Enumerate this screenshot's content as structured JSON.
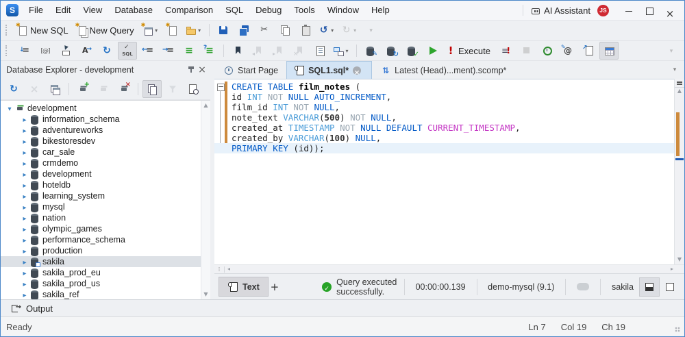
{
  "window": {
    "logo_letter": "S"
  },
  "colors": {
    "accent_blue": "#2f76c4",
    "keyword": "#0058c6",
    "datatype": "#4a9cd8",
    "secondary_keyword_gray": "#9aa7b2",
    "builtin_magenta": "#c436c4",
    "change_bar_orange": "#cd8a3c",
    "success_green": "#27a327",
    "execute_red": "#c00000",
    "active_tab": "#d3e4f5",
    "tree_selection": "#dde1e6"
  },
  "menubar": {
    "items": [
      "File",
      "Edit",
      "View",
      "Database",
      "Comparison",
      "SQL",
      "Debug",
      "Tools",
      "Window",
      "Help"
    ],
    "right": {
      "ai_label": "AI Assistant",
      "badge": "JS"
    },
    "window_controls": [
      "minimize",
      "maximize",
      "close-window"
    ]
  },
  "toolbar_main": [
    {
      "icon": "grip"
    },
    {
      "icon": "new-sql",
      "label": "New SQL"
    },
    {
      "icon": "new-query",
      "label": "New Query"
    },
    {
      "icon": "new-window",
      "caret": true
    },
    {
      "icon": "new-file"
    },
    {
      "icon": "open-folder",
      "caret": true
    },
    {
      "sep": true
    },
    {
      "icon": "save"
    },
    {
      "icon": "save-all"
    },
    {
      "icon": "cut"
    },
    {
      "icon": "copy"
    },
    {
      "icon": "paste"
    },
    {
      "icon": "undo",
      "caret": true
    },
    {
      "icon": "redo",
      "caret": true,
      "disabled": true
    },
    {
      "icon": "overflow",
      "disabled": true
    }
  ],
  "toolbar_sql": [
    {
      "icon": "grip"
    },
    {
      "icon": "format-document"
    },
    {
      "icon": "at-parameters"
    },
    {
      "icon": "goto"
    },
    {
      "icon": "auto-format"
    },
    {
      "icon": "refresh"
    },
    {
      "icon": "validate-sql",
      "active": true
    },
    {
      "icon": "outdent"
    },
    {
      "icon": "indent"
    },
    {
      "icon": "comment"
    },
    {
      "icon": "uncomment"
    },
    {
      "sep": true
    },
    {
      "icon": "bookmark"
    },
    {
      "icon": "bookmark-prev",
      "disabled": true
    },
    {
      "icon": "bookmark-next",
      "disabled": true
    },
    {
      "icon": "bookmark-clear",
      "disabled": true
    },
    {
      "icon": "doc-lines"
    },
    {
      "icon": "query-plan",
      "caret": true
    },
    {
      "sep": true
    },
    {
      "icon": "db-edit"
    },
    {
      "icon": "db-refresh"
    },
    {
      "icon": "db-check"
    },
    {
      "icon": "run"
    },
    {
      "icon": "execute-bang",
      "label": "Execute"
    },
    {
      "icon": "execute-script"
    },
    {
      "icon": "stop",
      "disabled": true
    },
    {
      "icon": "history"
    },
    {
      "icon": "profile-at"
    },
    {
      "icon": "plan-doc"
    },
    {
      "icon": "data-grid",
      "active": true
    },
    {
      "icon": "overflow",
      "disabled": true,
      "push_right": true
    }
  ],
  "explorer": {
    "title": "Database Explorer - development",
    "toolbar": [
      {
        "icon": "refresh"
      },
      {
        "icon": "delete",
        "disabled": true
      },
      {
        "icon": "windows"
      },
      {
        "sep": true
      },
      {
        "icon": "connection-add"
      },
      {
        "icon": "connection-off",
        "disabled": true
      },
      {
        "icon": "connection-remove"
      },
      {
        "sep": true
      },
      {
        "icon": "documents",
        "active": true
      },
      {
        "icon": "filter",
        "disabled": true
      },
      {
        "icon": "doc-history"
      }
    ],
    "tree": [
      {
        "label": "development",
        "level": 0,
        "icon": "connection",
        "expanded": true
      },
      {
        "label": "information_schema",
        "level": 1,
        "icon": "database"
      },
      {
        "label": "adventureworks",
        "level": 1,
        "icon": "database"
      },
      {
        "label": "bikestoresdev",
        "level": 1,
        "icon": "database"
      },
      {
        "label": "car_sale",
        "level": 1,
        "icon": "database"
      },
      {
        "label": "crmdemo",
        "level": 1,
        "icon": "database"
      },
      {
        "label": "development",
        "level": 1,
        "icon": "database"
      },
      {
        "label": "hoteldb",
        "level": 1,
        "icon": "database"
      },
      {
        "label": "learning_system",
        "level": 1,
        "icon": "database"
      },
      {
        "label": "mysql",
        "level": 1,
        "icon": "database"
      },
      {
        "label": "nation",
        "level": 1,
        "icon": "database"
      },
      {
        "label": "olympic_games",
        "level": 1,
        "icon": "database"
      },
      {
        "label": "performance_schema",
        "level": 1,
        "icon": "database"
      },
      {
        "label": "production",
        "level": 1,
        "icon": "database"
      },
      {
        "label": "sakila",
        "level": 1,
        "icon": "database-current",
        "selected": true
      },
      {
        "label": "sakila_prod_eu",
        "level": 1,
        "icon": "database"
      },
      {
        "label": "sakila_prod_us",
        "level": 1,
        "icon": "database"
      },
      {
        "label": "sakila_ref",
        "level": 1,
        "icon": "database"
      }
    ]
  },
  "tabs": [
    {
      "label": "Start Page",
      "icon": "start-page"
    },
    {
      "label": "SQL1.sql*",
      "icon": "sql-doc",
      "active": true,
      "closable": true
    },
    {
      "label": "Latest (Head)...ment).scomp*",
      "icon": "compare-doc"
    }
  ],
  "editor": {
    "current_line": 7,
    "lines": [
      [
        [
          "CREATE TABLE",
          "k"
        ],
        [
          " ",
          "p"
        ],
        [
          "film_notes",
          "b"
        ],
        [
          " (",
          "p"
        ]
      ],
      [
        [
          "id ",
          "p"
        ],
        [
          "INT",
          "t"
        ],
        [
          " ",
          "p"
        ],
        [
          "NOT",
          "g"
        ],
        [
          " ",
          "p"
        ],
        [
          "NULL",
          "k"
        ],
        [
          " ",
          "p"
        ],
        [
          "AUTO_INCREMENT",
          "k"
        ],
        [
          ",",
          "p"
        ]
      ],
      [
        [
          "film_id ",
          "p"
        ],
        [
          "INT",
          "t"
        ],
        [
          " ",
          "p"
        ],
        [
          "NOT",
          "g"
        ],
        [
          " ",
          "p"
        ],
        [
          "NULL",
          "k"
        ],
        [
          ",",
          "p"
        ]
      ],
      [
        [
          "note_text ",
          "p"
        ],
        [
          "VARCHAR",
          "t"
        ],
        [
          "(",
          "p"
        ],
        [
          "500",
          "n"
        ],
        [
          ") ",
          "p"
        ],
        [
          "NOT",
          "g"
        ],
        [
          " ",
          "p"
        ],
        [
          "NULL",
          "k"
        ],
        [
          ",",
          "p"
        ]
      ],
      [
        [
          "created_at ",
          "p"
        ],
        [
          "TIMESTAMP",
          "t"
        ],
        [
          " ",
          "p"
        ],
        [
          "NOT",
          "g"
        ],
        [
          " ",
          "p"
        ],
        [
          "NULL",
          "k"
        ],
        [
          " ",
          "p"
        ],
        [
          "DEFAULT",
          "k"
        ],
        [
          " ",
          "p"
        ],
        [
          "CURRENT_TIMESTAMP",
          "m"
        ],
        [
          ",",
          "p"
        ]
      ],
      [
        [
          "created_by ",
          "p"
        ],
        [
          "VARCHAR",
          "t"
        ],
        [
          "(",
          "p"
        ],
        [
          "100",
          "n"
        ],
        [
          ") ",
          "p"
        ],
        [
          "NULL",
          "k"
        ],
        [
          ",",
          "p"
        ]
      ],
      [
        [
          "PRIMARY KEY",
          "k"
        ],
        [
          " (id));",
          "p"
        ]
      ]
    ]
  },
  "doc_status": {
    "tab_label": "Text",
    "add_tab_label": "+",
    "message": "Query executed successfully.",
    "duration": "00:00:00.139",
    "connection": "demo-mysql (9.1)",
    "database": "sakila"
  },
  "output": {
    "title": "Output"
  },
  "statusbar": {
    "ready": "Ready",
    "ln": "Ln 7",
    "col": "Col 19",
    "ch": "Ch 19"
  }
}
